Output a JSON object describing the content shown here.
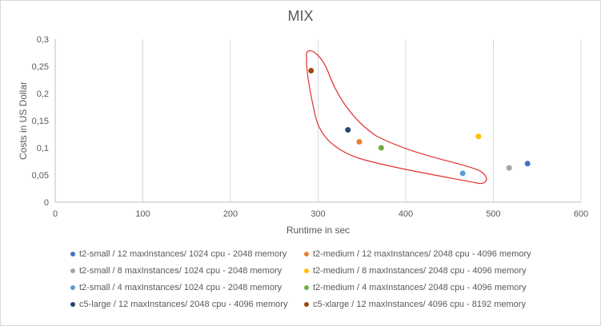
{
  "chart_data": {
    "type": "scatter",
    "title": "MIX",
    "xlabel": "Runtime in sec",
    "ylabel": "Costs in US Dollar",
    "xlim": [
      0,
      600
    ],
    "ylim": [
      0,
      0.3
    ],
    "x_ticks": [
      "0",
      "100",
      "200",
      "300",
      "400",
      "500",
      "600"
    ],
    "y_ticks": [
      "0",
      "0,05",
      "0,1",
      "0,15",
      "0,2",
      "0,25",
      "0,3"
    ],
    "grid": "vertical",
    "legend_position": "bottom",
    "series": [
      {
        "name": "t2-small / 12 maxInstances/ 1024 cpu - 2048 memory",
        "color": "#4472c4",
        "points": [
          [
            539,
            0.071
          ]
        ]
      },
      {
        "name": "t2-medium / 12 maxInstances/ 2048 cpu - 4096 memory",
        "color": "#ed7d31",
        "points": [
          [
            347,
            0.111
          ]
        ]
      },
      {
        "name": "t2-small / 8 maxInstances/ 1024 cpu - 2048 memory",
        "color": "#a5a5a5",
        "points": [
          [
            518,
            0.063
          ]
        ]
      },
      {
        "name": "t2-medium / 8 maxInstances/ 2048 cpu - 4096 memory",
        "color": "#ffc000",
        "points": [
          [
            483,
            0.121
          ]
        ]
      },
      {
        "name": "t2-small / 4 maxInstances/ 1024 cpu - 2048 memory",
        "color": "#5b9bd5",
        "points": [
          [
            465,
            0.053
          ]
        ]
      },
      {
        "name": "t2-medium / 4 maxInstances/ 2048 cpu - 4096 memory",
        "color": "#70ad47",
        "points": [
          [
            372,
            0.1
          ]
        ]
      },
      {
        "name": "c5-large / 12 maxInstances/ 2048 cpu - 4096 memory",
        "color": "#264478",
        "points": [
          [
            334,
            0.133
          ]
        ]
      },
      {
        "name": "c5-xlarge / 12 maxInstances/ 4096 cpu - 8192 memory",
        "color": "#9e480e",
        "points": [
          [
            292,
            0.242
          ]
        ]
      }
    ],
    "annotation": {
      "type": "freehand-outline",
      "color": "#e03030"
    }
  }
}
